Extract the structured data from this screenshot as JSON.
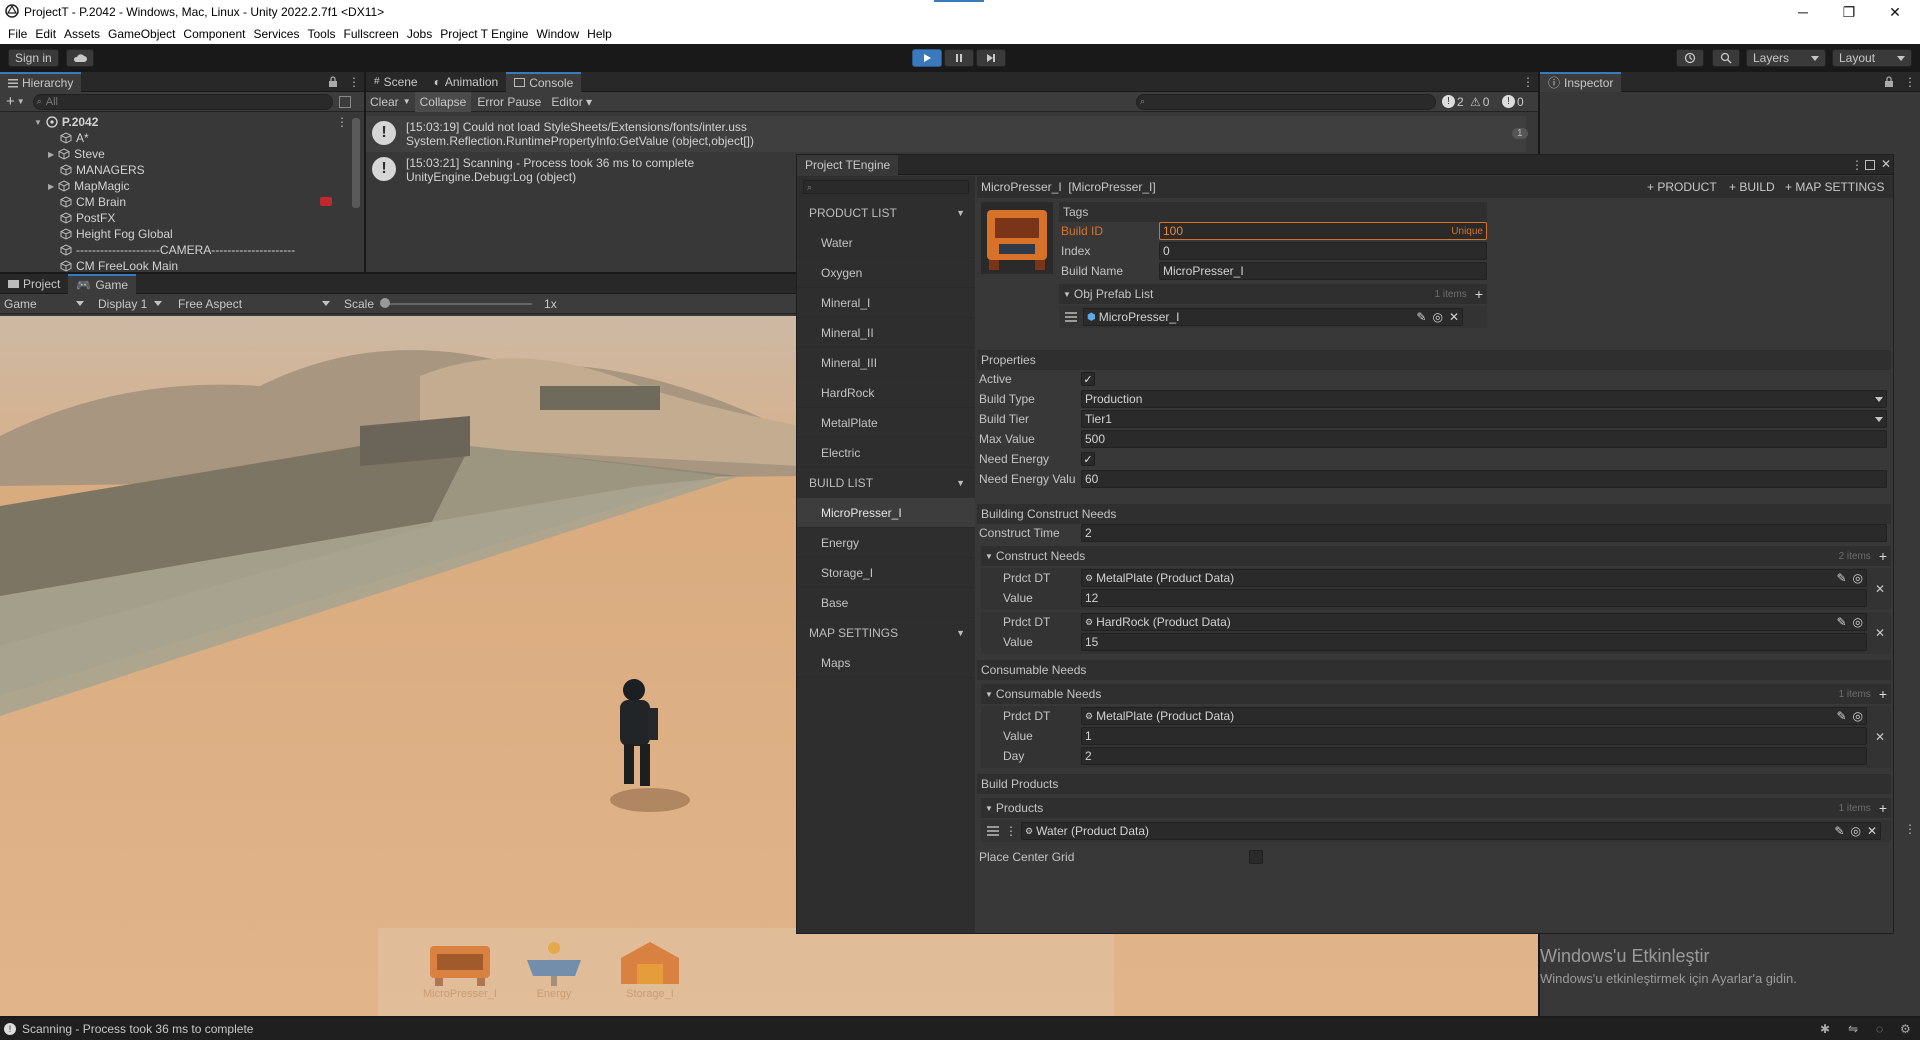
{
  "window": {
    "title": "ProjectT - P.2042 - Windows, Mac, Linux - Unity 2022.2.7f1 <DX11>",
    "minimize": "─",
    "maximize": "❐",
    "close": "✕"
  },
  "menu": [
    "File",
    "Edit",
    "Assets",
    "GameObject",
    "Component",
    "Services",
    "Tools",
    "Fullscreen",
    "Jobs",
    "Project T Engine",
    "Window",
    "Help"
  ],
  "toolbar": {
    "sign_in": "Sign in",
    "layers": "Layers",
    "layout": "Layout"
  },
  "hierarchy": {
    "tab": "Hierarchy",
    "search_placeholder": "All",
    "scene": "P.2042",
    "items": [
      "A*",
      "Steve",
      "MANAGERS",
      "MapMagic",
      "CM Brain",
      "PostFX",
      "Height Fog Global",
      "---------------------CAMERA---------------------",
      "CM FreeLook Main"
    ]
  },
  "console": {
    "tabs": [
      "Scene",
      "Animation",
      "Console"
    ],
    "buttons": {
      "clear": "Clear",
      "collapse": "Collapse",
      "error_pause": "Error Pause",
      "editor": "Editor"
    },
    "counts": {
      "log": "2",
      "warn": "0",
      "err": "0"
    },
    "badge": "1",
    "messages": [
      {
        "line1": "[15:03:19] Could not load StyleSheets/Extensions/fonts/inter.uss",
        "line2": "System.Reflection.RuntimePropertyInfo:GetValue (object,object[])"
      },
      {
        "line1": "[15:03:21] Scanning - Process took 36 ms to complete",
        "line2": "UnityEngine.Debug:Log (object)"
      }
    ]
  },
  "game": {
    "tabs": [
      "Project",
      "Game"
    ],
    "display_mode": "Game",
    "display": "Display 1",
    "aspect": "Free Aspect",
    "scale_label": "Scale",
    "scale_value": "1x",
    "hud_items": [
      "MicroPresser_I",
      "Energy",
      "Storage_I"
    ]
  },
  "inspector": {
    "tab": "Inspector"
  },
  "engine": {
    "title": "Project TEngine",
    "header": "MicroPresser_I  [MicroPresser_I]",
    "actions": [
      "+ PRODUCT",
      "+ BUILD",
      "+ MAP SETTINGS"
    ],
    "nav": {
      "product_list": "PRODUCT LIST",
      "products": [
        "Water",
        "Oxygen",
        "Mineral_I",
        "Mineral_II",
        "Mineral_III",
        "HardRock",
        "MetalPlate",
        "Electric"
      ],
      "build_list": "BUILD LIST",
      "builds": [
        "MicroPresser_I",
        "Energy",
        "Storage_I",
        "Base"
      ],
      "map_settings": "MAP SETTINGS",
      "maps": [
        "Maps"
      ]
    },
    "tags": {
      "title": "Tags",
      "build_id_label": "Build ID",
      "build_id": "100",
      "unique": "Unique",
      "index_label": "Index",
      "index": "0",
      "build_name_label": "Build Name",
      "build_name": "MicroPresser_I",
      "obj_prefab_label": "Obj Prefab List",
      "obj_prefab_count": "1 items",
      "obj_prefab_item": "MicroPresser_I"
    },
    "properties": {
      "title": "Properties",
      "active_label": "Active",
      "build_type_label": "Build Type",
      "build_type": "Production",
      "build_tier_label": "Build Tier",
      "build_tier": "Tier1",
      "max_value_label": "Max Value",
      "max_value": "500",
      "need_energy_label": "Need Energy",
      "need_energy_value_label": "Need Energy Valu",
      "need_energy_value": "60"
    },
    "construct": {
      "title": "Building Construct Needs",
      "time_label": "Construct Time",
      "time": "2",
      "list_label": "Construct Needs",
      "list_count": "2 items",
      "prdct_label": "Prdct DT",
      "value_label": "Value",
      "items": [
        {
          "product": "MetalPlate (Product Data)",
          "value": "12"
        },
        {
          "product": "HardRock (Product Data)",
          "value": "15"
        }
      ]
    },
    "consumable": {
      "title": "Consumable Needs",
      "list_label": "Consumable Needs",
      "list_count": "1 items",
      "prdct_label": "Prdct DT",
      "value_label": "Value",
      "day_label": "Day",
      "product": "MetalPlate (Product Data)",
      "value": "1",
      "day": "2"
    },
    "build_products": {
      "title": "Build Products",
      "list_label": "Products",
      "list_count": "1 items",
      "item": "Water (Product Data)"
    },
    "place_center_grid": "Place Center Grid"
  },
  "watermark": {
    "line1": "Windows'u Etkinleştir",
    "line2": "Windows'u etkinleştirmek için Ayarlar'a gidin."
  },
  "status": {
    "text": "Scanning - Process took 36 ms to complete"
  },
  "colors": {
    "accent": "#3a79bb",
    "orange": "#d6722a",
    "sand": "#d9a878"
  }
}
